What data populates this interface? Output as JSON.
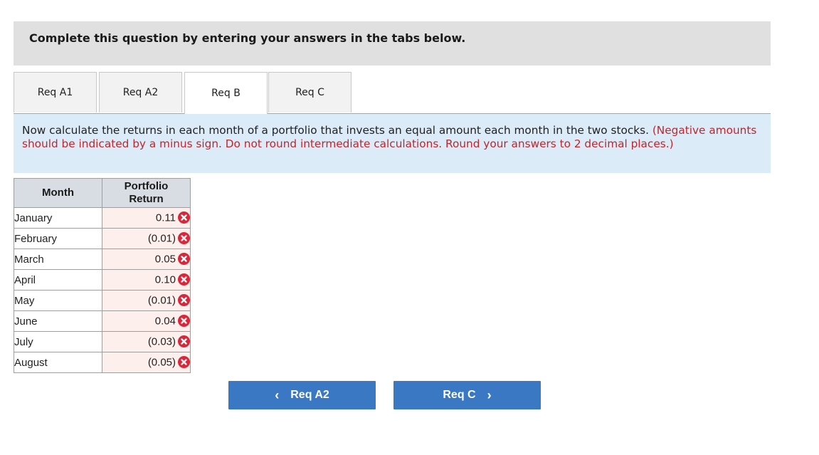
{
  "header": {
    "title": "Complete this question by entering your answers in the tabs below."
  },
  "tabs": [
    {
      "label": "Req A1",
      "active": false
    },
    {
      "label": "Req A2",
      "active": false
    },
    {
      "label": "Req B",
      "active": true
    },
    {
      "label": "Req C",
      "active": false
    }
  ],
  "instructions": {
    "text": "Now calculate the returns in each month of a portfolio that invests an equal amount each month in the two stocks.",
    "note": "(Negative amounts should be indicated by a minus sign. Do not round intermediate calculations. Round your answers to 2 decimal places.)"
  },
  "table": {
    "headers": {
      "month": "Month",
      "return_line1": "Portfolio",
      "return_line2": "Return"
    },
    "rows": [
      {
        "month": "January",
        "value": "0.11",
        "status": "incorrect"
      },
      {
        "month": "February",
        "value": "(0.01)",
        "status": "incorrect"
      },
      {
        "month": "March",
        "value": "0.05",
        "status": "incorrect"
      },
      {
        "month": "April",
        "value": "0.10",
        "status": "incorrect"
      },
      {
        "month": "May",
        "value": "(0.01)",
        "status": "incorrect"
      },
      {
        "month": "June",
        "value": "0.04",
        "status": "incorrect"
      },
      {
        "month": "July",
        "value": "(0.03)",
        "status": "incorrect"
      },
      {
        "month": "August",
        "value": "(0.05)",
        "status": "incorrect"
      }
    ]
  },
  "nav": {
    "prev_label": "Req A2",
    "prev_icon": "chevron-left-icon",
    "next_label": "Req C",
    "next_icon": "chevron-right-icon"
  },
  "colors": {
    "accent": "#3a78c3",
    "error": "#d9263a",
    "instruction_bg": "#dcebf8",
    "note_red": "#c0262b"
  }
}
